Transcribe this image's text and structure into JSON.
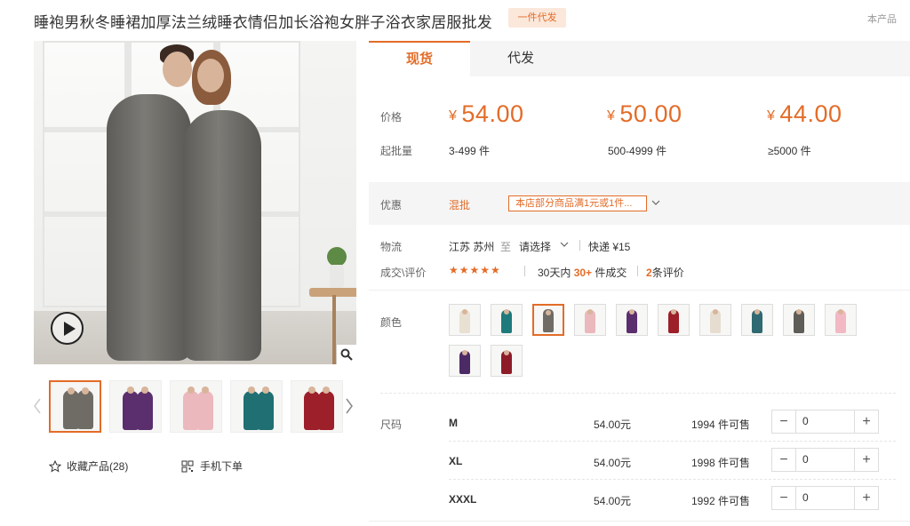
{
  "product": {
    "title": "睡袍男秋冬睡裙加厚法兰绒睡衣情侣加长浴袍女胖子浴衣家居服批发",
    "badge": "一件代发",
    "top_right_text": "本产品"
  },
  "gallery": {
    "favorite_label": "收藏产品(28)",
    "mobile_order_label": "手机下单",
    "thumbnails": [
      {
        "color": "#6f6c66",
        "active": true
      },
      {
        "color": "#5b2e6e",
        "active": false
      },
      {
        "color": "#eab8bd",
        "active": false
      },
      {
        "color": "#1f6f73",
        "active": false
      },
      {
        "color": "#9c1f2a",
        "active": false
      }
    ]
  },
  "tabs": {
    "in_stock": "现货",
    "dropship": "代发"
  },
  "pricing": {
    "price_label": "价格",
    "moq_label": "起批量",
    "currency_symbol": "¥",
    "tiers": [
      {
        "price": "54.00",
        "quantity": "3-499 件"
      },
      {
        "price": "50.00",
        "quantity": "500-4999 件"
      },
      {
        "price": "44.00",
        "quantity": "≥5000 件"
      }
    ]
  },
  "promotion": {
    "label": "优惠",
    "type": "混批",
    "tag": "本店部分商品满1元或1件..."
  },
  "logistics": {
    "label": "物流",
    "origin": "江苏 苏州",
    "to": "至",
    "destination": "请选择",
    "shipping": "快递 ¥15"
  },
  "transactions": {
    "label": "成交\\评价",
    "stars": "★★★★★",
    "days_prefix": "30天内",
    "count": "30+",
    "deals_suffix": "件成交",
    "review_count": "2",
    "review_suffix": "条评价"
  },
  "color_section": {
    "label": "颜色",
    "swatches": [
      {
        "color": "#e8e0d2",
        "active": false
      },
      {
        "color": "#1f7a7c",
        "active": false
      },
      {
        "color": "#6f6c66",
        "active": true
      },
      {
        "color": "#eab8bd",
        "active": false
      },
      {
        "color": "#5b2e6e",
        "active": false
      },
      {
        "color": "#9c1f2a",
        "active": false
      },
      {
        "color": "#e6ddd0",
        "active": false
      },
      {
        "color": "#2f6a72",
        "active": false
      },
      {
        "color": "#5f5d58",
        "active": false
      },
      {
        "color": "#f2b9c4",
        "active": false
      },
      {
        "color": "#4c2a66",
        "active": false
      },
      {
        "color": "#8e1c28",
        "active": false
      }
    ]
  },
  "sizes": {
    "label": "尺码",
    "rows": [
      {
        "name": "M",
        "price": "54.00元",
        "stock": "1994 件可售",
        "qty": "0"
      },
      {
        "name": "XL",
        "price": "54.00元",
        "stock": "1998 件可售",
        "qty": "0"
      },
      {
        "name": "XXXL",
        "price": "54.00元",
        "stock": "1992 件可售",
        "qty": "0"
      }
    ],
    "minus": "−",
    "plus": "+"
  }
}
